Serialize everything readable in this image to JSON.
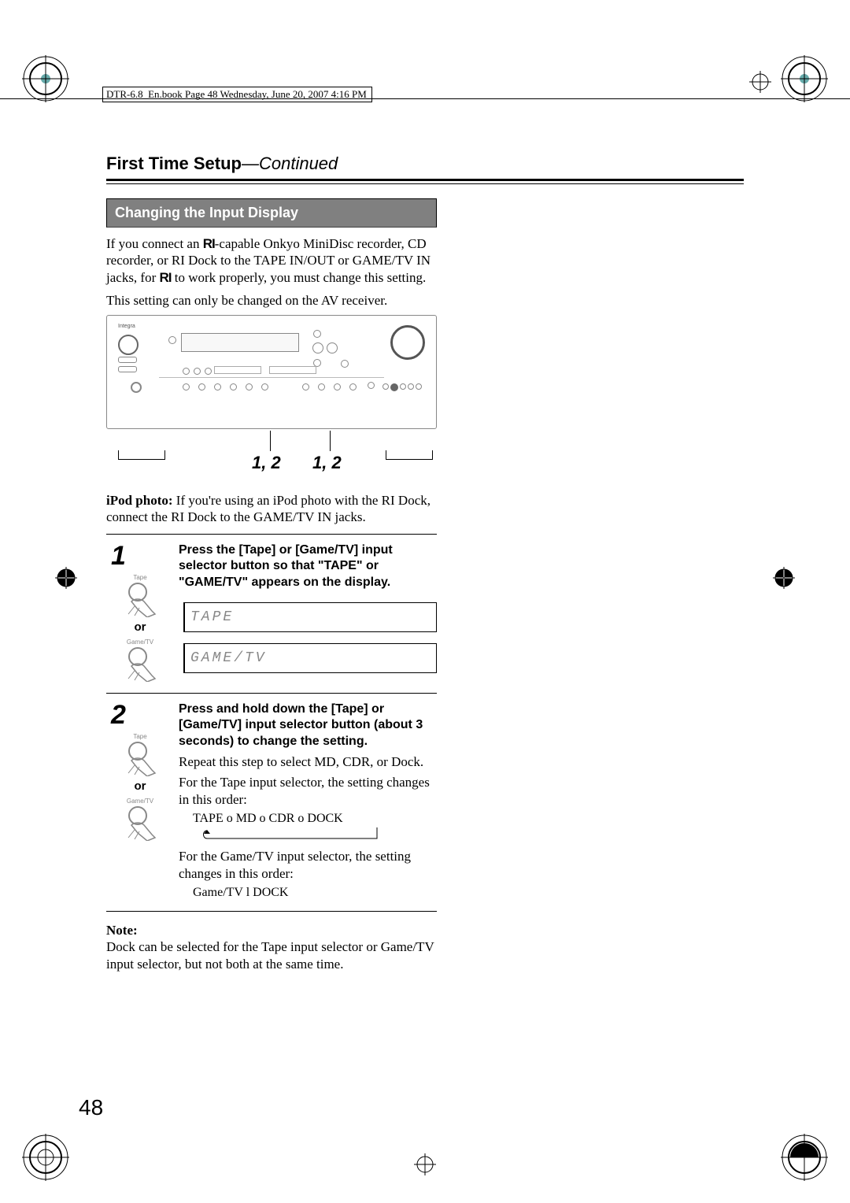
{
  "header_line": "DTR-6.8_En.book  Page 48  Wednesday, June 20, 2007  4:16 PM",
  "section_title": "First Time Setup",
  "section_suffix": "—Continued",
  "gray_bar": "Changing the Input Display",
  "intro_1a": "If you connect an ",
  "intro_1b": "-capable Onkyo MiniDisc recorder, CD recorder, or RI Dock to the TAPE IN/OUT or GAME/TV IN jacks, for ",
  "intro_1c": " to work properly, you must change this setting.",
  "intro_2": "This setting can only be changed on the AV receiver.",
  "ri_symbol": "RI",
  "fig_label_left": "1, 2",
  "fig_label_right": "1, 2",
  "ipod_bold": "iPod photo:",
  "ipod_rest": " If you're using an iPod photo with the RI Dock, connect the RI Dock to the GAME/TV IN jacks.",
  "step1": {
    "num": "1",
    "btn1": "Tape",
    "or": "or",
    "btn2": "Game/TV",
    "heading": "Press the [Tape] or [Game/TV] input selector button so that \"TAPE\" or \"GAME/TV\" appears on the display.",
    "lcd1": "TAPE",
    "lcd2": "GAME/TV"
  },
  "step2": {
    "num": "2",
    "btn1": "Tape",
    "or": "or",
    "btn2": "Game/TV",
    "heading": "Press and hold down the [Tape] or [Game/TV] input selector button (about 3 seconds) to change the setting.",
    "body1": "Repeat this step to select MD, CDR, or Dock.",
    "body2": "For the Tape input selector, the setting changes in this order:",
    "cycle1": "TAPE o   MD o   CDR o   DOCK",
    "body3": "For the Game/TV input selector, the setting changes in this order:",
    "cycle2": "Game/TV l   DOCK"
  },
  "note_title": "Note:",
  "note_text": "Dock can be selected for the Tape input selector or Game/TV input selector, but not both at the same time.",
  "page_num": "48"
}
